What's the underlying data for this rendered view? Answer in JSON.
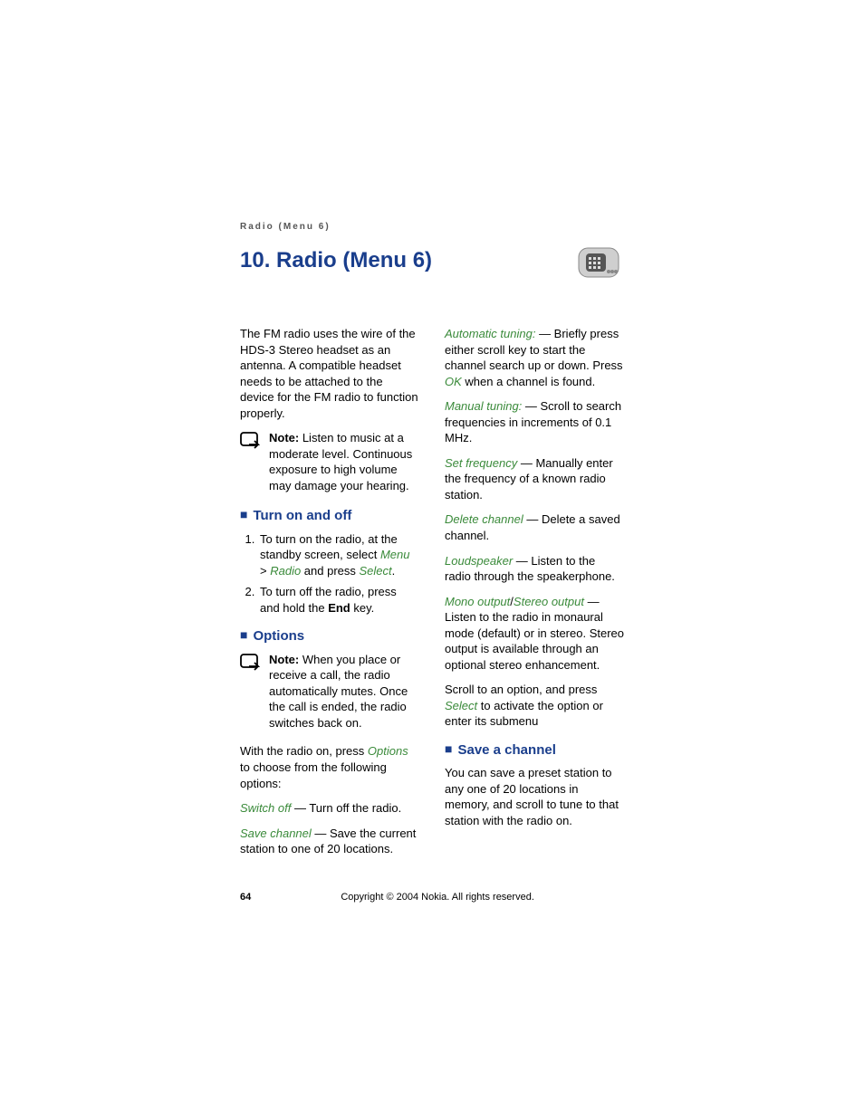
{
  "header": {
    "running": "Radio (Menu 6)",
    "title": "10. Radio (Menu 6)"
  },
  "col1": {
    "intro": "The FM radio uses the wire of the HDS-3 Stereo headset as an antenna. A compatible headset needs to be attached to the device for the FM radio to function properly.",
    "note1_label": "Note:",
    "note1_text": " Listen to music at a moderate level. Continuous exposure to high volume may damage your hearing.",
    "sec_turn": "Turn on and off",
    "step1_a": "To turn on the radio, at the standby screen, select ",
    "menu": "Menu",
    "gt": " > ",
    "radio": "Radio",
    "step1_b": " and press ",
    "select": "Select",
    "period": ".",
    "step2_a": "To turn off the radio, press and hold the ",
    "end": "End",
    "step2_b": " key.",
    "sec_options": "Options",
    "note2_label": "Note:",
    "note2_text": " When you place or receive a call, the radio automatically mutes. Once the call is ended, the radio switches back on.",
    "p_with_radio_a": "With the radio on, press ",
    "options": "Options",
    "p_with_radio_b": " to choose from the following options:",
    "switch_off": "Switch off",
    "switch_off_text": " — Turn off the radio.",
    "save_channel": "Save channel",
    "save_channel_text": " — Save the current station to one of 20 locations."
  },
  "col2": {
    "auto_tuning": "Automatic tuning:",
    "auto_text_a": " — Briefly press either scroll key to start the channel search up or down. Press ",
    "ok": "OK",
    "auto_text_b": " when a channel is found.",
    "manual_tuning": "Manual tuning:",
    "manual_text": " — Scroll to search frequencies in increments of 0.1 MHz.",
    "set_freq": "Set frequency",
    "set_freq_text": " — Manually enter the frequency of a known radio station.",
    "delete_ch": "Delete channel",
    "delete_ch_text": " — Delete a saved channel.",
    "loudspeaker": "Loudspeaker",
    "loudspeaker_text": " — Listen to the radio through the speakerphone.",
    "mono": "Mono output",
    "slash": "/",
    "stereo": "Stereo output",
    "mono_text": " — Listen to the radio in monaural mode (default) or in stereo. Stereo output is available through an optional stereo enhancement.",
    "scroll_a": "Scroll to an option, and press ",
    "scroll_select": "Select",
    "scroll_b": " to activate the option or enter its submenu",
    "sec_save": "Save a channel",
    "save_text": "You can save a preset station to any one of 20 locations in memory, and scroll to tune to that station with the radio on."
  },
  "footer": {
    "page": "64",
    "copyright": "Copyright © 2004 Nokia. All rights reserved."
  }
}
